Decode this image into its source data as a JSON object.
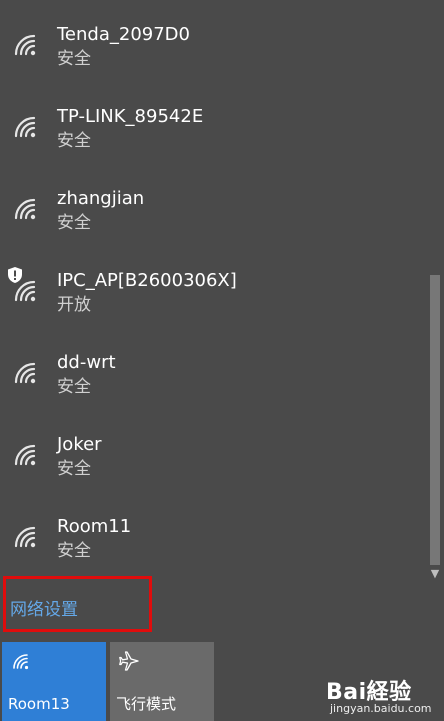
{
  "networks": [
    {
      "ssid": "Tenda_2097D0",
      "security": "安全"
    },
    {
      "ssid": "TP-LINK_89542E",
      "security": "安全"
    },
    {
      "ssid": "zhangjian",
      "security": "安全"
    },
    {
      "ssid": "IPC_AP[B2600306X]",
      "security": "开放"
    },
    {
      "ssid": "dd-wrt",
      "security": "安全"
    },
    {
      "ssid": "Joker",
      "security": "安全"
    },
    {
      "ssid": "Room11",
      "security": "安全"
    }
  ],
  "settings_link": "网络设置",
  "tiles": {
    "wifi_label": "Room13",
    "airplane_label": "飞行模式"
  },
  "watermark": {
    "logo": "Bai経验",
    "url": "jingyan.baidu.com"
  },
  "colors": {
    "panel_bg": "#4a4a4a",
    "accent_tile": "#2f7fd6",
    "link": "#64a8e8",
    "highlight": "#e00c0c"
  },
  "icons": {
    "network": "wifi-icon",
    "open_network_warning": "shield-icon",
    "airplane": "airplane-icon"
  }
}
